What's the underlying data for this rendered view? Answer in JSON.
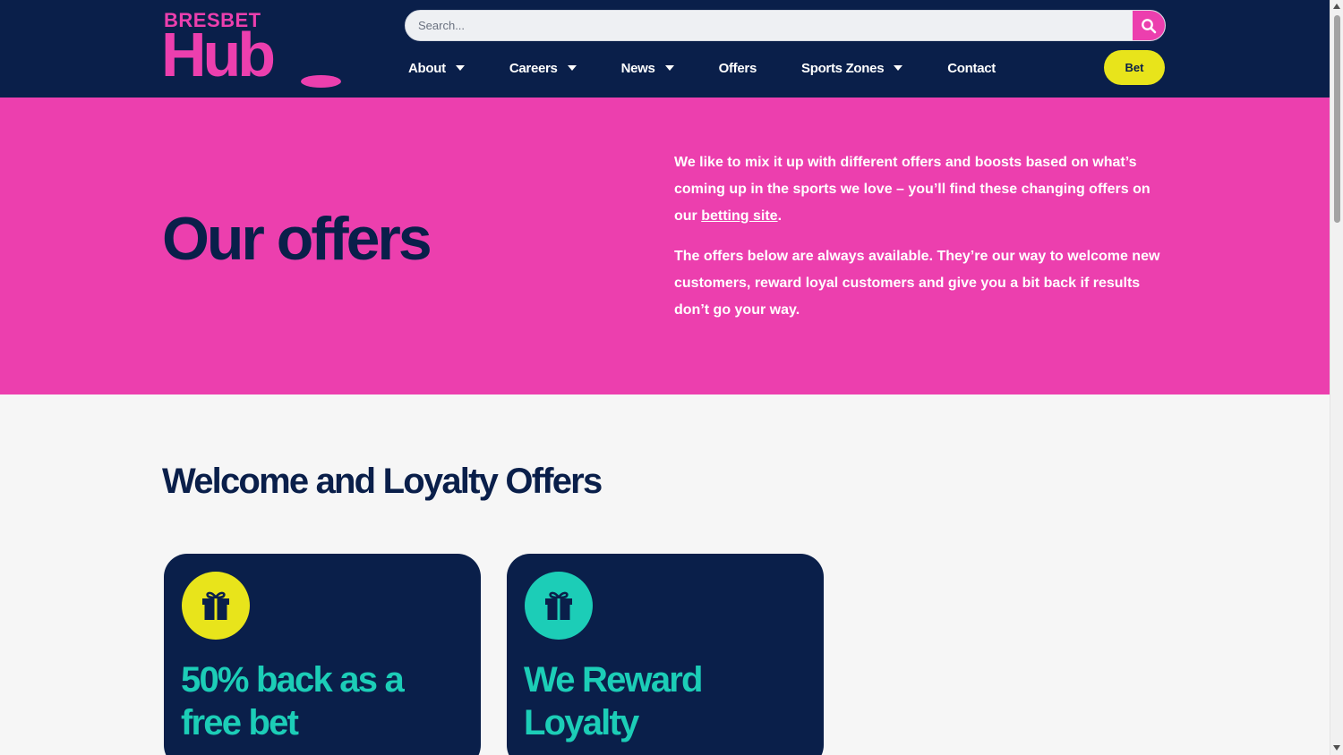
{
  "brand": {
    "name_top": "BRESBET",
    "name_main": "Hub"
  },
  "search": {
    "placeholder": "Search...",
    "icon": "search-icon"
  },
  "nav": {
    "items": [
      {
        "label": "About",
        "dropdown": true
      },
      {
        "label": "Careers",
        "dropdown": true
      },
      {
        "label": "News",
        "dropdown": true
      },
      {
        "label": "Offers",
        "dropdown": false
      },
      {
        "label": "Sports Zones",
        "dropdown": true
      },
      {
        "label": "Contact",
        "dropdown": false
      }
    ],
    "bet_label": "Bet"
  },
  "hero": {
    "title": "Our offers",
    "para1_before_link": "We like to mix it up with different offers and boosts based on what’s coming up in the sports we love – you’ll find these changing offers on our ",
    "para1_link": "betting site",
    "para1_after_link": ".",
    "para2": "The offers below are always available. They’re our way to welcome new customers, reward loyal customers and give you a bit back if results don’t go your way."
  },
  "offers": {
    "section_title": "Welcome and Loyalty Offers",
    "cards": [
      {
        "title": "50% back as a free bet",
        "icon": "gift-icon",
        "icon_bg": "#e8e41b"
      },
      {
        "title": "We Reward Loyalty",
        "icon": "gift-icon",
        "icon_bg": "#1ccdb7"
      }
    ]
  },
  "colors": {
    "navy": "#0a1f4a",
    "pink": "#ec3fae",
    "yellow": "#e8e41b",
    "teal": "#1ccdb7"
  }
}
